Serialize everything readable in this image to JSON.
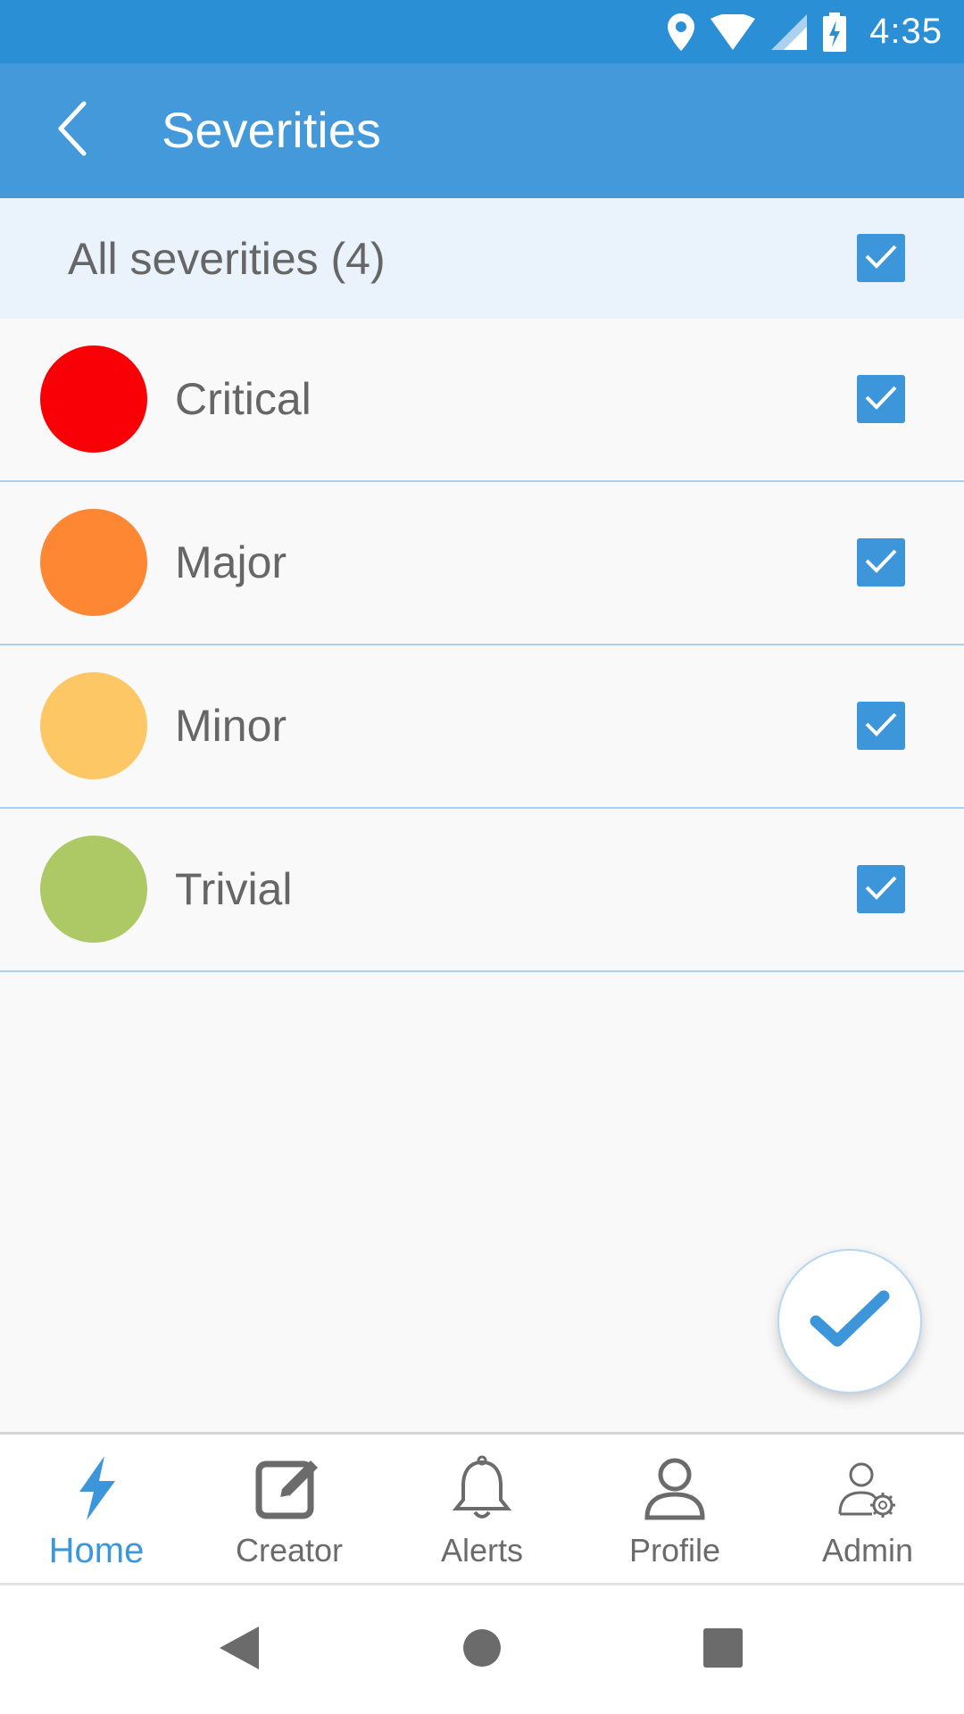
{
  "status_bar": {
    "time": "4:35",
    "icons": [
      "location-icon",
      "wifi-icon",
      "cell-signal-icon",
      "battery-charging-icon"
    ]
  },
  "app_bar": {
    "title": "Severities",
    "back_icon": "chevron-left-icon"
  },
  "select_all": {
    "label": "All severities (4)",
    "checked": true
  },
  "severities": [
    {
      "label": "Critical",
      "color": "#f90006",
      "checked": true
    },
    {
      "label": "Major",
      "color": "#fe8733",
      "checked": true
    },
    {
      "label": "Minor",
      "color": "#fec765",
      "checked": true
    },
    {
      "label": "Trivial",
      "color": "#adc965",
      "checked": true
    }
  ],
  "fab": {
    "icon": "checkmark-icon"
  },
  "bottom_nav": {
    "items": [
      {
        "label": "Home",
        "icon": "lightning-icon",
        "active": true
      },
      {
        "label": "Creator",
        "icon": "edit-icon",
        "active": false
      },
      {
        "label": "Alerts",
        "icon": "bell-icon",
        "active": false
      },
      {
        "label": "Profile",
        "icon": "user-icon",
        "active": false
      },
      {
        "label": "Admin",
        "icon": "admin-gear-icon",
        "active": false
      }
    ]
  },
  "system_nav": {
    "icons": [
      "back-triangle-icon",
      "home-circle-icon",
      "recents-square-icon"
    ]
  },
  "colors": {
    "status_bar": "#2b8fd5",
    "app_bar": "#4399d9",
    "accent": "#3d96da",
    "select_all_bg": "#eaf2fb",
    "divider": "#a9d1f0"
  }
}
